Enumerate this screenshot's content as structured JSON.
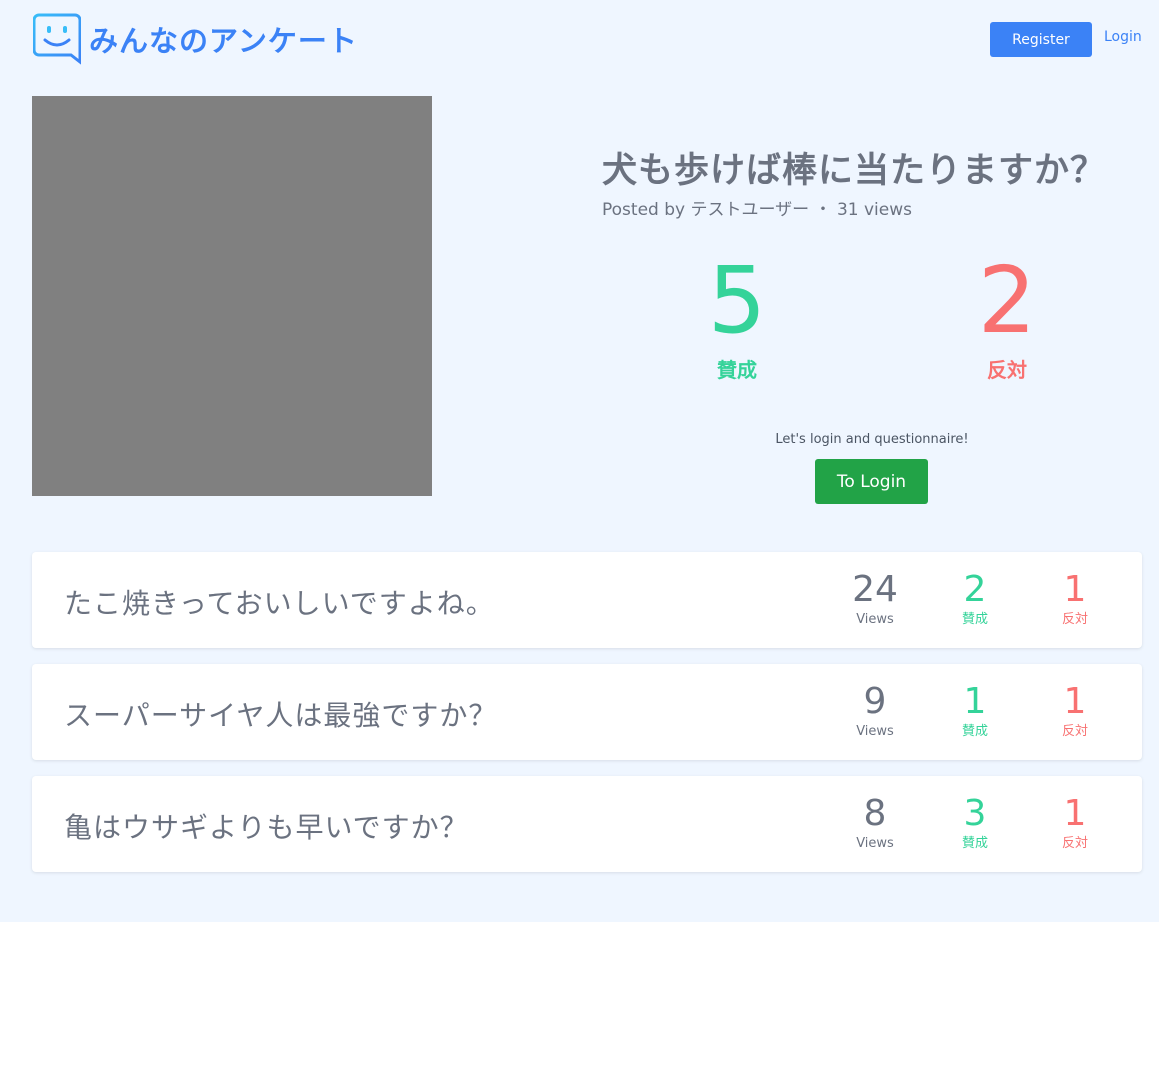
{
  "header": {
    "logo_text": "みんなのアンケート",
    "register_label": "Register",
    "login_label": "Login"
  },
  "featured": {
    "title": "犬も歩けば棒に当たりますか？",
    "meta": "Posted by テストユーザー ・ 31 views",
    "agree_count": "5",
    "agree_label": "賛成",
    "disagree_count": "2",
    "disagree_label": "反対",
    "login_prompt": "Let's login and questionnaire!",
    "login_button": "To Login"
  },
  "questions": [
    {
      "title": "たこ焼きっておいしいですよね。",
      "views": "24",
      "views_label": "Views",
      "agree": "2",
      "agree_label": "賛成",
      "disagree": "1",
      "disagree_label": "反対"
    },
    {
      "title": "スーパーサイヤ人は最強ですか？",
      "views": "9",
      "views_label": "Views",
      "agree": "1",
      "agree_label": "賛成",
      "disagree": "1",
      "disagree_label": "反対"
    },
    {
      "title": "亀はウサギよりも早いですか？",
      "views": "8",
      "views_label": "Views",
      "agree": "3",
      "agree_label": "賛成",
      "disagree": "1",
      "disagree_label": "反対"
    }
  ],
  "colors": {
    "brand": "#3b82f6",
    "agree": "#34d399",
    "disagree": "#f87171",
    "login_button": "#22a347",
    "page_background": "#eff6ff"
  }
}
